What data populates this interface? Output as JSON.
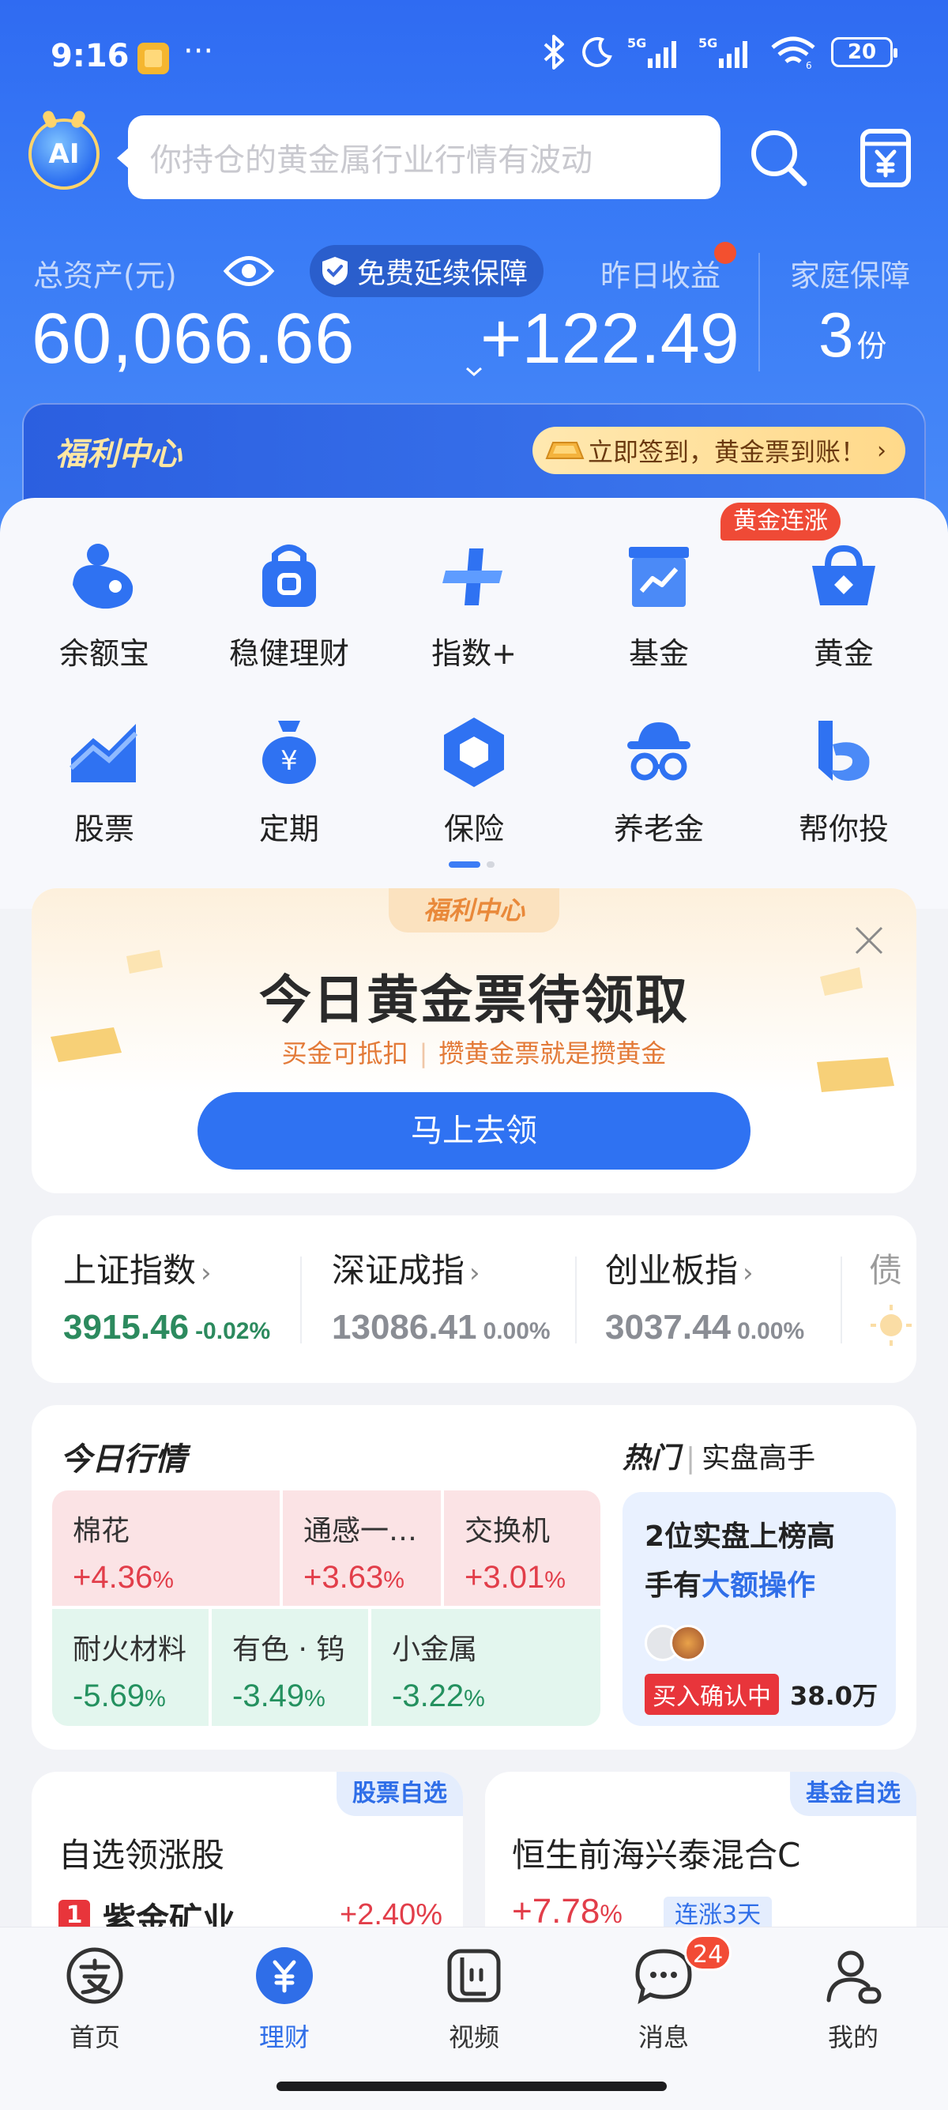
{
  "status_bar": {
    "time": "9:16",
    "dots": "···",
    "battery": "20",
    "network1": "5G",
    "network2": "5G",
    "wifi_sub": "6"
  },
  "search": {
    "placeholder": "你持仓的黄金属行业行情有波动",
    "ai_label": "AI"
  },
  "assets": {
    "label": "总资产(元)",
    "value": "60,066.66",
    "guarantee": "免费延续保障",
    "yesterday_label": "昨日收益",
    "yesterday_value": "+122.49",
    "family_label": "家庭保障",
    "family_value": "3",
    "family_unit": "份"
  },
  "welfare": {
    "title": "福利中心",
    "signin": "立即签到，黄金票到账！"
  },
  "grid": {
    "gold_tag": "黄金连涨",
    "items": [
      {
        "label": "余额宝"
      },
      {
        "label": "稳健理财"
      },
      {
        "label": "指数+"
      },
      {
        "label": "基金"
      },
      {
        "label": "黄金"
      },
      {
        "label": "股票"
      },
      {
        "label": "定期"
      },
      {
        "label": "保险"
      },
      {
        "label": "养老金"
      },
      {
        "label": "帮你投"
      }
    ]
  },
  "promo": {
    "tab": "福利中心",
    "title": "今日黄金票待领取",
    "sub_left": "买金可抵扣",
    "sub_sep": "|",
    "sub_right": "攒黄金票就是攒黄金",
    "button": "马上去领"
  },
  "indices": [
    {
      "name": "上证指数",
      "value": "3915.46",
      "change": "-0.02%"
    },
    {
      "name": "深证成指",
      "value": "13086.41",
      "change": "0.00%"
    },
    {
      "name": "创业板指",
      "value": "3037.44",
      "change": "0.00%"
    },
    {
      "name": "债"
    }
  ],
  "market": {
    "title": "今日行情",
    "hot_label": "热门",
    "hot_sub": "实盘高手",
    "tiles": [
      {
        "name": "棉花",
        "value": "+4.36",
        "unit": "%"
      },
      {
        "name": "通感一…",
        "value": "+3.63",
        "unit": "%"
      },
      {
        "name": "交换机",
        "value": "+3.01",
        "unit": "%"
      },
      {
        "name": "耐火材料",
        "value": "-5.69",
        "unit": "%"
      },
      {
        "name": "有色 · 钨",
        "value": "-3.49",
        "unit": "%"
      },
      {
        "name": "小金属",
        "value": "-3.22",
        "unit": "%"
      }
    ],
    "hot_card": {
      "line1": "2位实盘上榜高",
      "line2_prefix": "手有",
      "line2_em": "大额操作",
      "buy_tag": "买入确认中",
      "amount": "38.0万"
    }
  },
  "stock_fav": {
    "tag": "股票自选",
    "title": "自选领涨股",
    "rank": "1",
    "name": "紫金矿业",
    "change": "+2.40%"
  },
  "fund_fav": {
    "tag": "基金自选",
    "title": "恒生前海兴泰混合C",
    "change": "+7.78",
    "unit": "%",
    "streak": "连涨3天"
  },
  "tabbar": {
    "items": [
      {
        "label": "首页"
      },
      {
        "label": "理财"
      },
      {
        "label": "视频"
      },
      {
        "label": "消息"
      },
      {
        "label": "我的"
      }
    ],
    "message_badge": "24"
  },
  "colors": {
    "brand_blue": "#2f6ee8",
    "up_red": "#e23e4a",
    "down_green": "#24915f",
    "gold_tag": "#ef4a36"
  }
}
